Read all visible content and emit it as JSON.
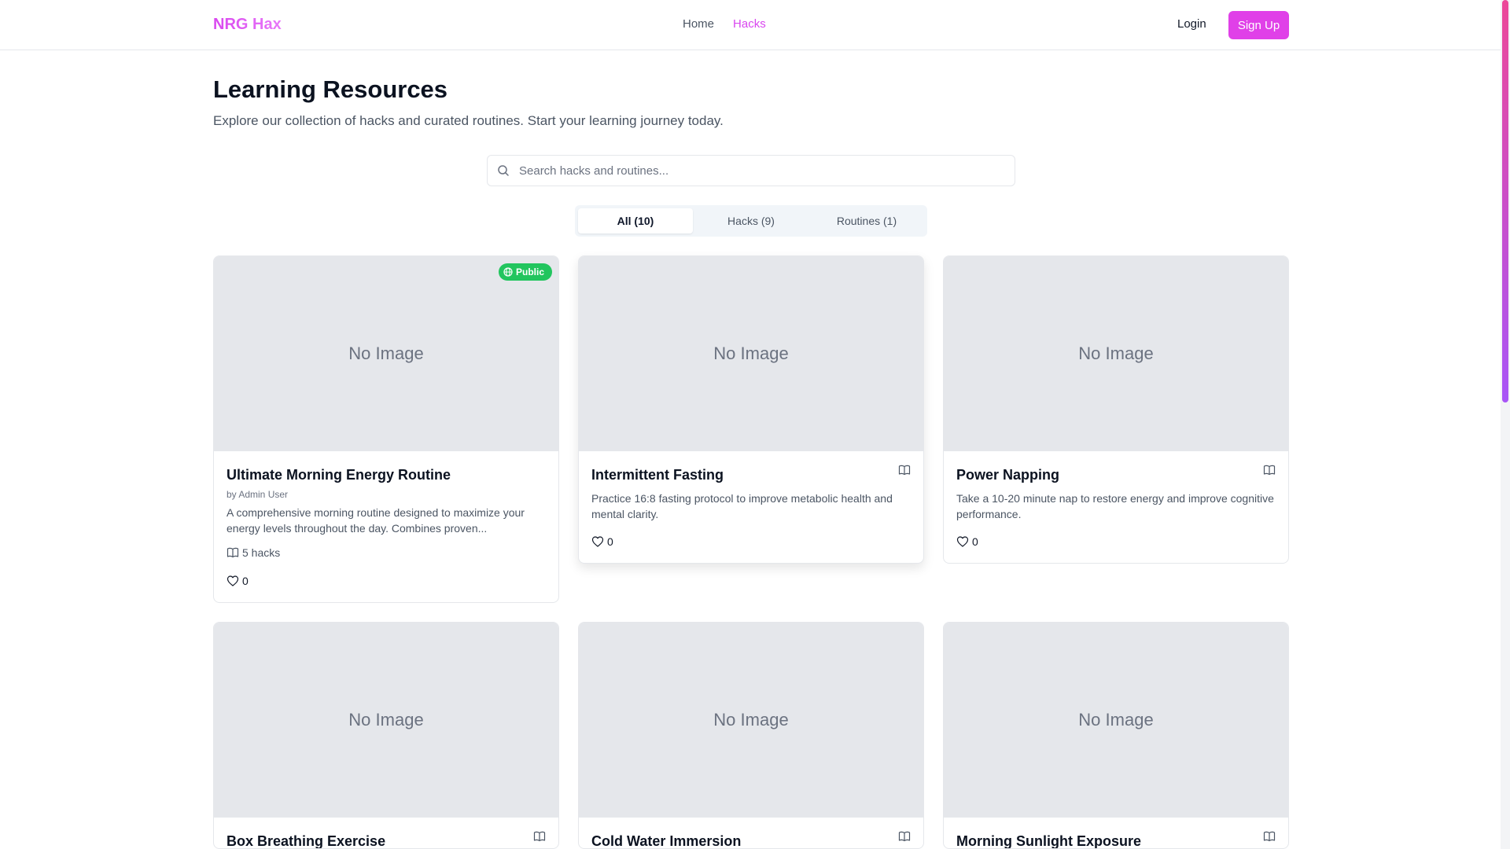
{
  "header": {
    "brand": "NRG Hax",
    "nav": [
      "Home",
      "Hacks"
    ],
    "login": "Login",
    "signup": "Sign Up"
  },
  "page": {
    "title": "Learning Resources",
    "subtitle": "Explore our collection of hacks and curated routines. Start your learning journey today."
  },
  "search": {
    "placeholder": "Search hacks and routines..."
  },
  "tabs": [
    "All (10)",
    "Hacks (9)",
    "Routines (1)"
  ],
  "cards": [
    {
      "image": "No Image",
      "badge": "Public",
      "title": "Ultimate Morning Energy Routine",
      "author": "by Admin User",
      "description": "A comprehensive morning routine designed to maximize your energy levels throughout the day. Combines proven...",
      "hacks_count": "5 hacks",
      "likes": "0"
    },
    {
      "image": "No Image",
      "title": "Intermittent Fasting",
      "description": "Practice 16:8 fasting protocol to improve metabolic health and mental clarity.",
      "likes": "0"
    },
    {
      "image": "No Image",
      "title": "Power Napping",
      "description": "Take a 10-20 minute nap to restore energy and improve cognitive performance.",
      "likes": "0"
    },
    {
      "image": "No Image",
      "title": "Box Breathing Exercise"
    },
    {
      "image": "No Image",
      "title": "Cold Water Immersion"
    },
    {
      "image": "No Image",
      "title": "Morning Sunlight Exposure"
    }
  ],
  "colors": {
    "accent": "#e040e8",
    "badge": "#22c55e",
    "placeholder_bg": "#e5e7eb"
  },
  "icons": [
    "search-icon",
    "globe-icon",
    "book-icon",
    "heart-icon"
  ]
}
